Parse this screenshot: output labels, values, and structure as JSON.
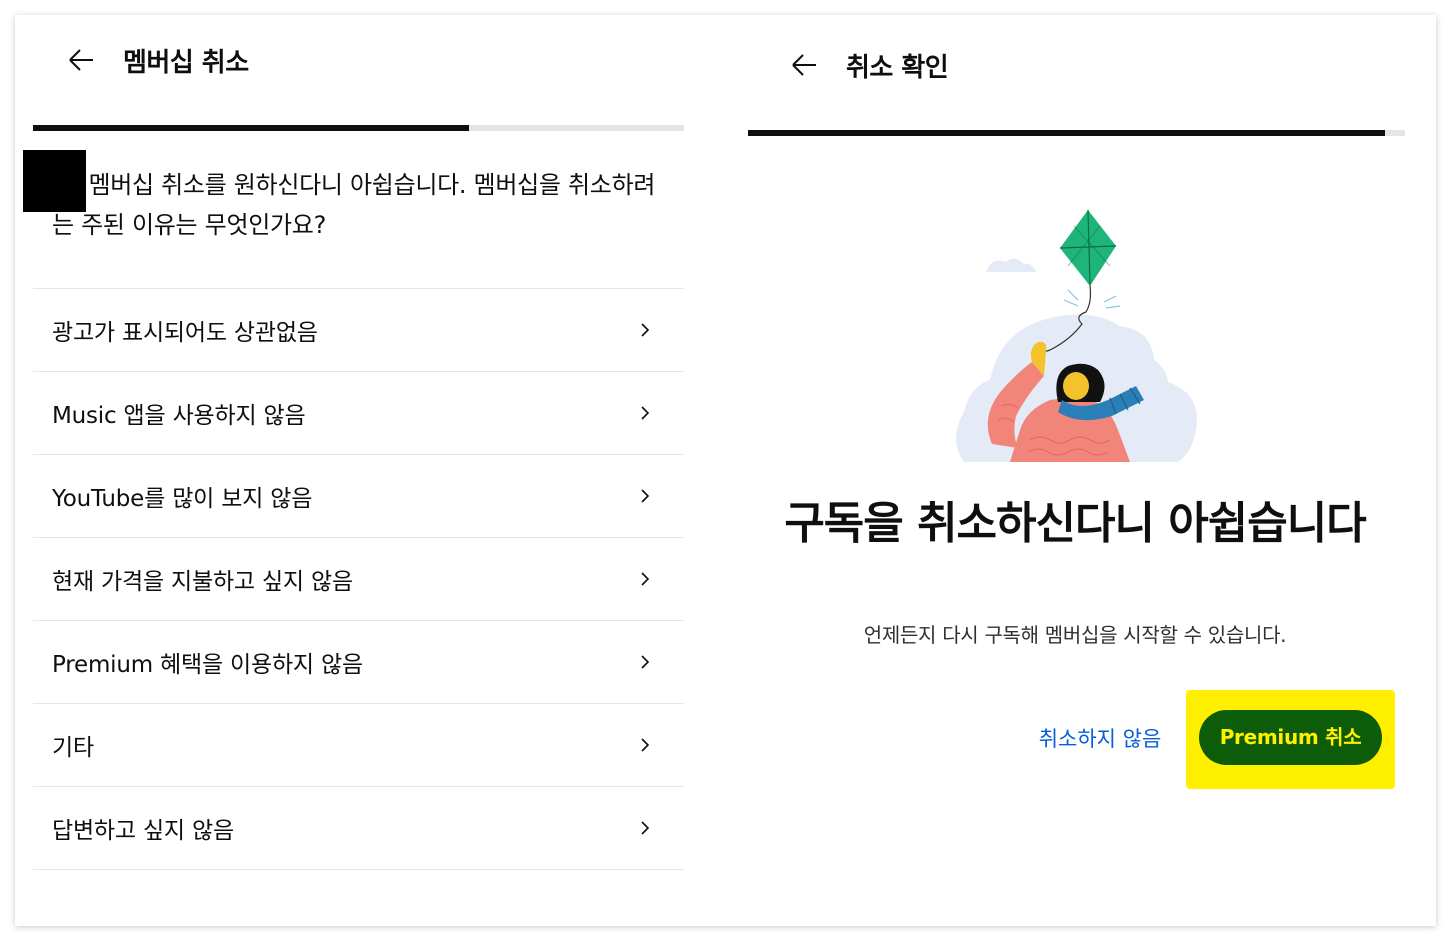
{
  "left": {
    "title": "멤버십 취소",
    "question": "님, 멤버십 취소를 원하신다니 아쉽습니다. 멤버십을 취소하려는 주된 이유는 무엇인가요?",
    "reasons": [
      {
        "label": "광고가 표시되어도 상관없음"
      },
      {
        "label": "Music 앱을 사용하지 않음"
      },
      {
        "label": "YouTube를 많이 보지 않음"
      },
      {
        "label": "현재 가격을 지불하고 싶지 않음"
      },
      {
        "label": "Premium 혜택을 이용하지 않음"
      },
      {
        "label": "기타"
      },
      {
        "label": "답변하고 싶지 않음"
      }
    ],
    "progress": 0.67
  },
  "right": {
    "title": "취소 확인",
    "headline": "구독을 취소하신다니 아쉽습니다",
    "subtext": "언제든지 다시 구독해 멤버십을 시작할 수 있습니다.",
    "dont_cancel_label": "취소하지 않음",
    "cancel_label": "Premium 취소",
    "progress": 0.97
  },
  "colors": {
    "link_blue": "#065fd4",
    "cancel_button_bg": "#0d5c0a",
    "cancel_button_text": "#fff000",
    "highlight": "#fff000"
  },
  "icons": {
    "back": "arrow-left-icon",
    "chevron": "chevron-right-icon",
    "illustration": "kite-illustration"
  }
}
